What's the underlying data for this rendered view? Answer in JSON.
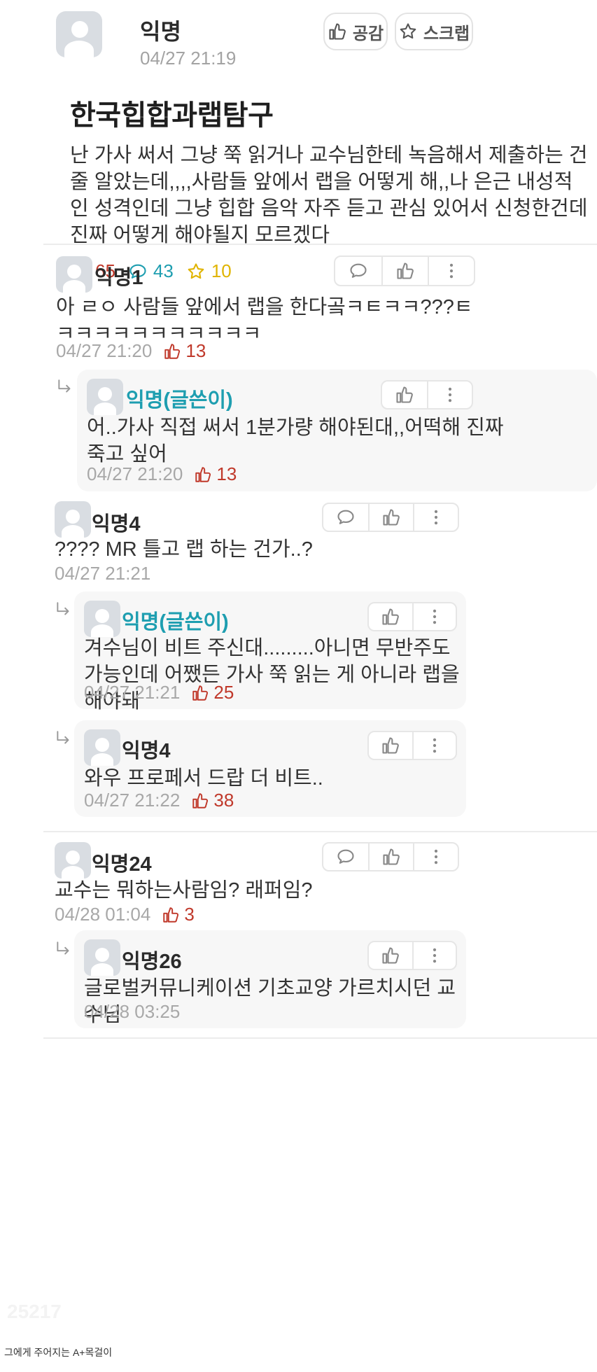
{
  "post": {
    "author": "익명",
    "time": "04/27 21:19",
    "empathy_label": "공감",
    "scrap_label": "스크랩",
    "title": "한국힙합과랩탐구",
    "body": "난 가사 써서 그냥 쭉 읽거나 교수님한테 녹음해서 제출하는 건 줄 알았는데,,,,사람들 앞에서 랩을 어떻게 해,,나 은근 내성적인 성격인데 그냥 힙합 음악 자주 듣고 관심 있어서 신청한건데 진짜 어떻게 해야될지 모르겠다",
    "stats": {
      "likes": "65",
      "comments": "43",
      "scraps": "10"
    }
  },
  "comments": [
    {
      "author": "익명1",
      "text": "아 ㄹㅇ 사람들 앞에서 랩을 한다곸ㅋㅌㅋㅋ???ㅌㅋㅋㅋㅋㅋㅋㅋㅋㅋㅋㅋ",
      "time": "04/27 21:20",
      "likes": "13",
      "replies": [
        {
          "author": "익명(글쓴이)",
          "text": "어..가사 직접 써서 1분가량 해야된대,,어떡해 진짜 죽고 싶어",
          "time": "04/27 21:20",
          "likes": "13"
        }
      ]
    },
    {
      "author": "익명4",
      "text": "???? MR 틀고 랩 하는 건가..?",
      "time": "04/27 21:21",
      "likes": "",
      "replies": [
        {
          "author": "익명(글쓴이)",
          "text": "겨수님이 비트 주신대.........아니면 무반주도 가능인데 어쨌든 가사 쭉 읽는 게 아니라 랩을 해야돼",
          "time": "04/27 21:21",
          "likes": "25"
        },
        {
          "author": "익명4",
          "text": "와우 프로페서 드랍 더 비트..",
          "time": "04/27 21:22",
          "likes": "38"
        }
      ]
    },
    {
      "author": "익명24",
      "text": "교수는 뭐하는사람임? 래퍼임?",
      "time": "04/28 01:04",
      "likes": "3",
      "replies": [
        {
          "author": "익명26",
          "text": "글로벌커뮤니케이션 기초교양 가르치시던 교수님",
          "time": "04/28 03:25",
          "likes": ""
        }
      ]
    }
  ],
  "watermark": "25217",
  "caption": "그에게 주어지는 A+목걸이",
  "colors": {
    "like": "#c0392b",
    "comment": "#1e9eb0",
    "scrap": "#e0b400",
    "op_name": "#1e9eb0"
  }
}
